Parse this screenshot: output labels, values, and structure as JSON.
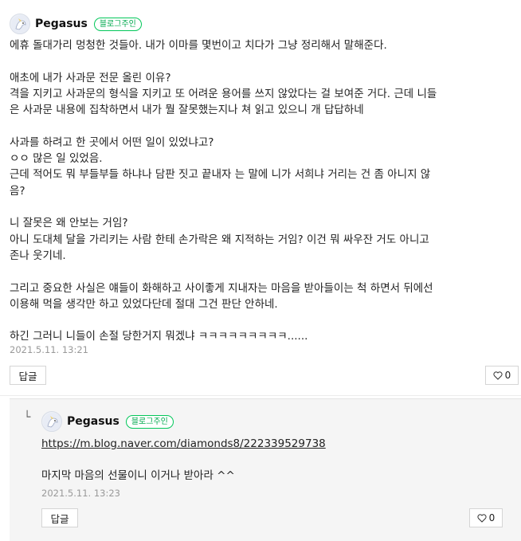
{
  "comment": {
    "author": "Pegasus",
    "badge": "블로그주인",
    "lines": [
      "에휴 돌대가리 멍청한 것들아. 내가 이마를 몇번이고 치다가 그냥 정리해서 말해준다.",
      "",
      "애초에 내가 사과문 전문 올린 이유?",
      "격을 지키고 사과문의 형식을 지키고 또 어려운 용어를 쓰지 않았다는 걸 보여준 거다. 근데 니들",
      "은 사과문 내용에 집착하면서 내가 뭘 잘못했는지나 쳐 읽고 있으니 개 답답하네",
      "",
      "사과를 하려고 한 곳에서 어떤 일이 있었냐고?",
      "ㅇㅇ 많은 일 있었음.",
      "근데 적어도 뭐 부들부들 하냐나 담판 짓고 끝내자 는 말에 니가 서희냐 거리는 건 좀 아니지 않",
      "음?",
      "",
      "니 잘못은 왜 안보는 거임?",
      "아니 도대체 달을 가리키는 사람 한테 손가락은 왜 지적하는 거임? 이건 뭐 싸우잔 거도 아니고",
      "존나 웃기네.",
      "",
      "그리고 중요한 사실은 얘들이 화해하고 사이좋게 지내자는 마음을 받아들이는 척 하면서 뒤에선",
      "이용해 먹을 생각만 하고 있었다단데 절대 그건 판단 안하네.",
      "",
      "하긴 그러니 니들이 손절 당한거지 뭐겠냐 ㅋㅋㅋㅋㅋㅋㅋㅋㅋ......"
    ],
    "date": "2021.5.11. 13:21",
    "reply_label": "답글",
    "like_count": "0"
  },
  "reply": {
    "arrow": "└",
    "author": "Pegasus",
    "badge": "블로그주인",
    "link": "https://m.blog.naver.com/diamonds8/222339529738",
    "text": "마지막 마음의 선물이니 이거나 받아라 ^^",
    "date": "2021.5.11. 13:23",
    "reply_label": "답글",
    "like_count": "0"
  },
  "icons": {
    "heart": "heart-icon",
    "avatar": "pegasus-avatar"
  },
  "colors": {
    "badge_green": "#03c75a",
    "date_gray": "#999999",
    "reply_bg": "#f5f5f5"
  }
}
